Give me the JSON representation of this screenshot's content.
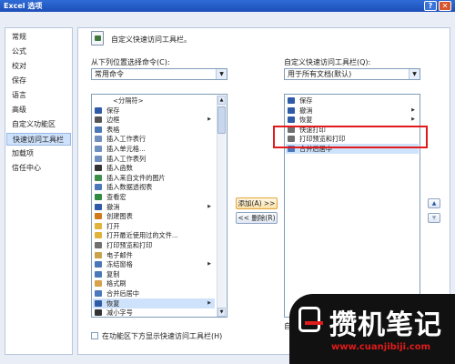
{
  "window": {
    "title": "Excel 选项",
    "help_glyph": "?",
    "close_glyph": "✕"
  },
  "nav": {
    "items": [
      {
        "label": "常规"
      },
      {
        "label": "公式"
      },
      {
        "label": "校对"
      },
      {
        "label": "保存"
      },
      {
        "label": "语言"
      },
      {
        "label": "高级"
      },
      {
        "label": "自定义功能区"
      },
      {
        "label": "快速访问工具栏",
        "selected": true
      },
      {
        "label": "加载项"
      },
      {
        "label": "信任中心"
      }
    ]
  },
  "header": {
    "text": "自定义快速访问工具栏。"
  },
  "left": {
    "label": "从下列位置选择命令(C):",
    "dropdown_value": "常用命令",
    "commands": [
      {
        "label": "<分隔符>",
        "icon": "separator-icon",
        "color": "#ffffff"
      },
      {
        "label": "保存",
        "icon": "save-icon",
        "color": "#2e5aa8"
      },
      {
        "label": "边框",
        "icon": "border-icon",
        "color": "#555555",
        "submenu": true
      },
      {
        "label": "表格",
        "icon": "table-icon",
        "color": "#4a78b8"
      },
      {
        "label": "插入工作表行",
        "icon": "insert-row-icon",
        "color": "#6f8fbf"
      },
      {
        "label": "插入单元格...",
        "icon": "insert-cells-icon",
        "color": "#6f8fbf"
      },
      {
        "label": "插入工作表列",
        "icon": "insert-column-icon",
        "color": "#6f8fbf"
      },
      {
        "label": "插入函数",
        "icon": "function-icon",
        "color": "#333333"
      },
      {
        "label": "插入来自文件的图片",
        "icon": "picture-icon",
        "color": "#3d8f4a"
      },
      {
        "label": "插入数据透视表",
        "icon": "pivot-icon",
        "color": "#4a78b8"
      },
      {
        "label": "查看宏",
        "icon": "macro-icon",
        "color": "#2d8a3e"
      },
      {
        "label": "撤消",
        "icon": "undo-icon",
        "color": "#2e5aa8",
        "submenu": true
      },
      {
        "label": "创建图表",
        "icon": "chart-icon",
        "color": "#d17a1c"
      },
      {
        "label": "打开",
        "icon": "open-icon",
        "color": "#e0b43a"
      },
      {
        "label": "打开最近使用过的文件...",
        "icon": "recent-file-icon",
        "color": "#e0b43a"
      },
      {
        "label": "打印预览和打印",
        "icon": "print-preview-icon",
        "color": "#6f6f6f"
      },
      {
        "label": "电子邮件",
        "icon": "email-icon",
        "color": "#caa24a"
      },
      {
        "label": "冻结窗格",
        "icon": "freeze-panes-icon",
        "color": "#4a78b8",
        "submenu": true
      },
      {
        "label": "复制",
        "icon": "copy-icon",
        "color": "#4a78b8"
      },
      {
        "label": "格式刷",
        "icon": "format-painter-icon",
        "color": "#d6a24a"
      },
      {
        "label": "合并后居中",
        "icon": "merge-center-icon",
        "color": "#4a78b8"
      },
      {
        "label": "恢复",
        "icon": "redo-icon",
        "color": "#2e5aa8",
        "submenu": true,
        "selected": true
      },
      {
        "label": "减小字号",
        "icon": "decrease-font-icon",
        "color": "#333333"
      }
    ],
    "checkbox_label": "在功能区下方显示快速访问工具栏(H)"
  },
  "middle": {
    "add_label": "添加(A) >>",
    "remove_label": "<< 删除(R)"
  },
  "right": {
    "label": "自定义快速访问工具栏(Q):",
    "dropdown_value": "用于所有文档(默认)",
    "items": [
      {
        "label": "保存",
        "icon": "save-icon",
        "color": "#2e5aa8"
      },
      {
        "label": "撤消",
        "icon": "undo-icon",
        "color": "#2e5aa8",
        "submenu": true
      },
      {
        "label": "恢复",
        "icon": "redo-icon",
        "color": "#2e5aa8",
        "submenu": true
      },
      {
        "label": "快速打印",
        "icon": "quick-print-icon",
        "color": "#6f6f6f"
      },
      {
        "label": "打印预览和打印",
        "icon": "print-preview-icon",
        "color": "#6f6f6f"
      },
      {
        "label": "合并后居中",
        "icon": "merge-center-icon",
        "color": "#4a78b8",
        "selected": true
      }
    ],
    "up_glyph": "▲",
    "down_glyph": "▼",
    "bottom_label": "自定"
  },
  "watermark": {
    "text": "攒机笔记",
    "url": "www.cuanjibiji.com"
  }
}
